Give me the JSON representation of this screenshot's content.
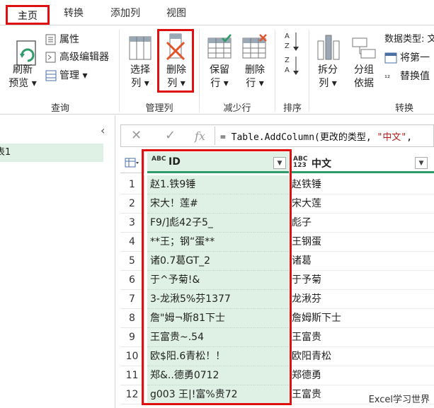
{
  "tabs": [
    "主页",
    "转换",
    "添加列",
    "视图"
  ],
  "ribbon": {
    "query_group": {
      "label": "查询",
      "refresh": [
        "刷新",
        "预览 ▾"
      ],
      "properties": "属性",
      "advanced_editor": "高级编辑器",
      "manage": "管理 ▾"
    },
    "manage_cols_group": {
      "label": "管理列",
      "choose_cols": [
        "选择",
        "列 ▾"
      ],
      "remove_cols": [
        "删除",
        "列 ▾"
      ]
    },
    "reduce_rows_group": {
      "label": "减少行",
      "keep_rows": [
        "保留",
        "行 ▾"
      ],
      "remove_rows": [
        "删除",
        "行 ▾"
      ]
    },
    "sort_group": {
      "label": "排序"
    },
    "transform_group": {
      "label": "转换",
      "split_col": [
        "拆分",
        "列 ▾"
      ],
      "group_by": [
        "分组",
        "依据"
      ],
      "data_type": "数据类型: 文",
      "first_row_header": "将第一",
      "replace_values": "替换值"
    }
  },
  "query_pane": {
    "item": "表1"
  },
  "formula_bar": {
    "fx": "fx",
    "prefix": "= Table.AddColumn(更改的类型, ",
    "string": "\"中文\"",
    "suffix": ","
  },
  "grid": {
    "columns": [
      {
        "type": "ABC",
        "name": "ID"
      },
      {
        "type": "ABC 123",
        "name": "中文"
      }
    ],
    "rows": [
      {
        "n": "1",
        "id": "赵1.铁9锤",
        "cn": "赵铁锤"
      },
      {
        "n": "2",
        "id": "宋大！莲#",
        "cn": "宋大莲"
      },
      {
        "n": "3",
        "id": "F9/]彪42子5_",
        "cn": "彪子"
      },
      {
        "n": "4",
        "id": "**王；钢“蛋**",
        "cn": "王钢蛋"
      },
      {
        "n": "5",
        "id": "诸0.7葛GT_2",
        "cn": "诸葛"
      },
      {
        "n": "6",
        "id": "于^予菊!&",
        "cn": "于予菊"
      },
      {
        "n": "7",
        "id": "3-龙湫5%芬1377",
        "cn": "龙湫芬"
      },
      {
        "n": "8",
        "id": "詹\"姆¬斯81下士",
        "cn": "詹姆斯下士"
      },
      {
        "n": "9",
        "id": "王富贵~.54",
        "cn": "王富贵"
      },
      {
        "n": "10",
        "id": "欧$阳.6青松！！",
        "cn": "欧阳青松"
      },
      {
        "n": "11",
        "id": "郑&..德勇0712",
        "cn": "郑德勇"
      },
      {
        "n": "12",
        "id": "g003 王|!富%贵72",
        "cn": "王富贵"
      }
    ]
  },
  "watermark": "Excel学习世界",
  "colors": {
    "highlight_red": "#e01010",
    "selected_col": "#dff1e4",
    "accent_green": "#2e9c6a"
  }
}
